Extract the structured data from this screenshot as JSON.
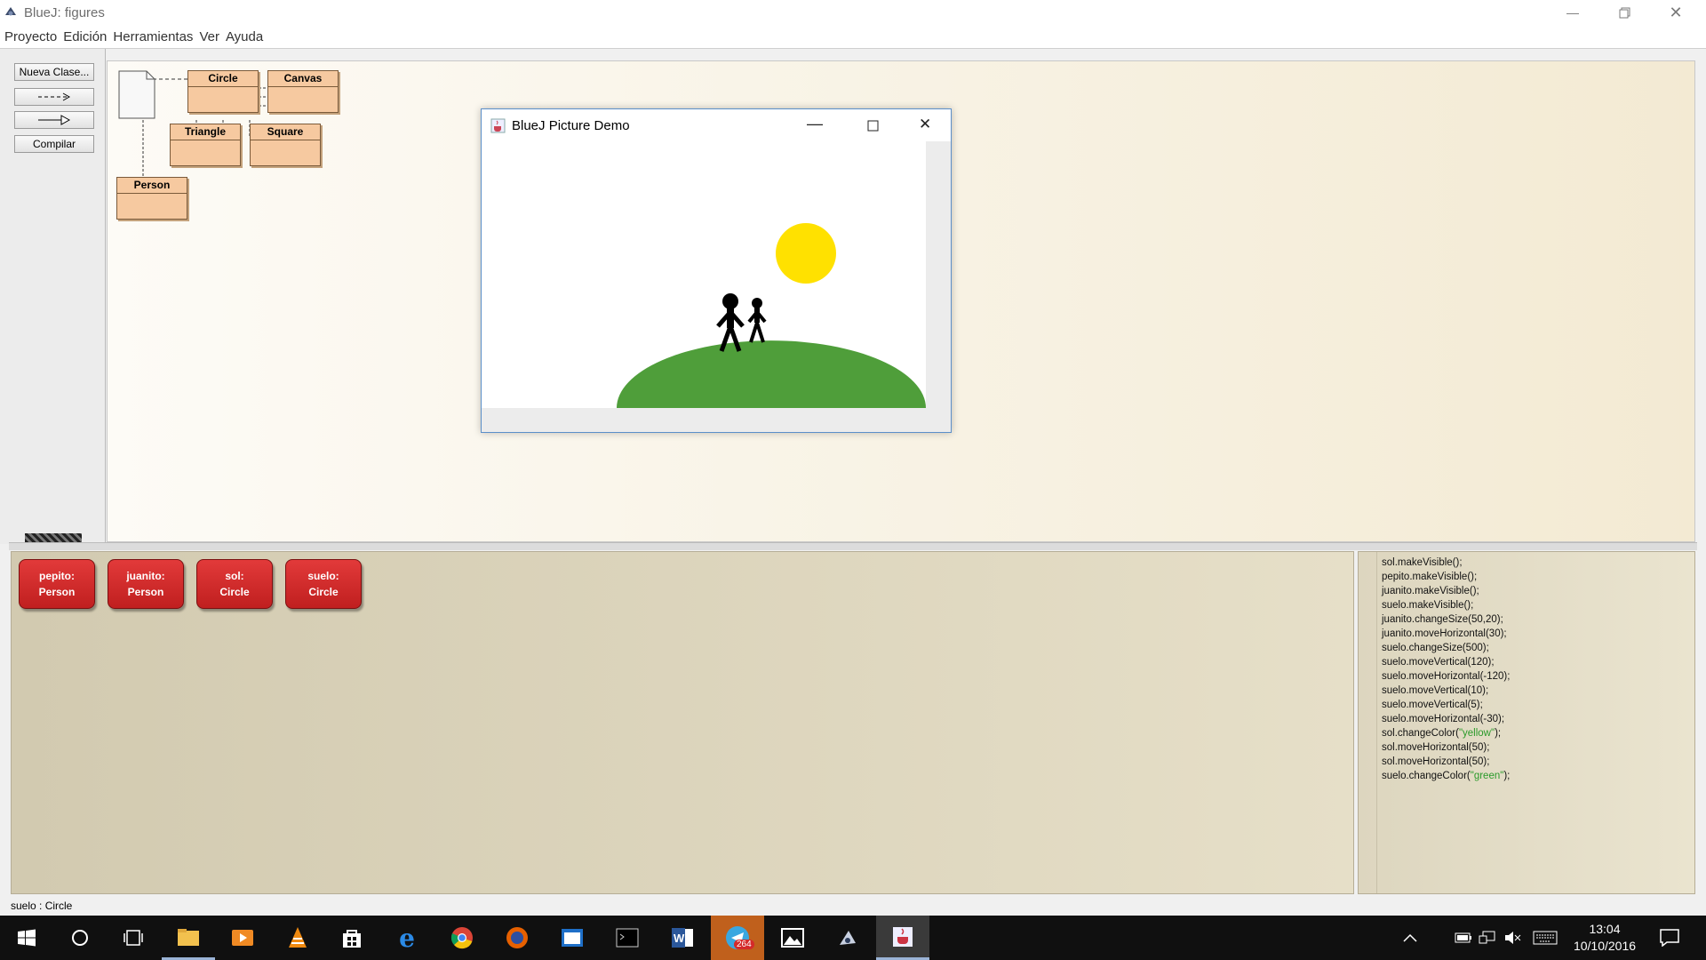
{
  "window": {
    "title": "BlueJ:  figures"
  },
  "menu": [
    "Proyecto",
    "Edición",
    "Herramientas",
    "Ver",
    "Ayuda"
  ],
  "toolbar": {
    "new_class": "Nueva Clase...",
    "dependency_arrow": "- - ->",
    "inheritance_arrow": "——▷",
    "compile": "Compilar"
  },
  "classes": {
    "circle": "Circle",
    "canvas": "Canvas",
    "triangle": "Triangle",
    "square": "Square",
    "person": "Person"
  },
  "demo_window": {
    "title": "BlueJ Picture Demo",
    "colors": {
      "sun": "#ffe100",
      "ground": "#4f9e3a",
      "person": "#000000"
    }
  },
  "objects": [
    {
      "name": "pepito:",
      "type": "Person"
    },
    {
      "name": "juanito:",
      "type": "Person"
    },
    {
      "name": "sol:",
      "type": "Circle"
    },
    {
      "name": "suelo:",
      "type": "Circle"
    }
  ],
  "codepad": {
    "lines": [
      "sol.makeVisible();",
      "pepito.makeVisible();",
      "juanito.makeVisible();",
      "suelo.makeVisible();",
      "juanito.changeSize(50,20);",
      "juanito.moveHorizontal(30);",
      "suelo.changeSize(500);",
      "suelo.moveVertical(120);",
      "suelo.moveHorizontal(-120);",
      "suelo.moveVertical(10);",
      "suelo.moveVertical(5);",
      "suelo.moveHorizontal(-30);"
    ],
    "color_line1": {
      "prefix": "sol.changeColor(",
      "string": "\"yellow\"",
      "suffix": ");"
    },
    "lines2": [
      "sol.moveHorizontal(50);",
      "sol.moveHorizontal(50);"
    ],
    "color_line2": {
      "prefix": "suelo.changeColor(",
      "string": "\"green\"",
      "suffix": ");"
    }
  },
  "status": "suelo : Circle",
  "taskbar": {
    "time": "13:04",
    "date": "10/10/2016",
    "telegram_badge": "264",
    "apps": [
      "start-icon",
      "cortana-icon",
      "task-view-icon",
      "file-explorer-icon",
      "media-player-icon",
      "vlc-icon",
      "store-icon",
      "edge-icon",
      "chrome-icon",
      "firefox-icon",
      "app-window-icon",
      "terminal-icon",
      "word-icon",
      "telegram-icon",
      "photos-icon",
      "bluej-icon",
      "java-icon"
    ]
  }
}
